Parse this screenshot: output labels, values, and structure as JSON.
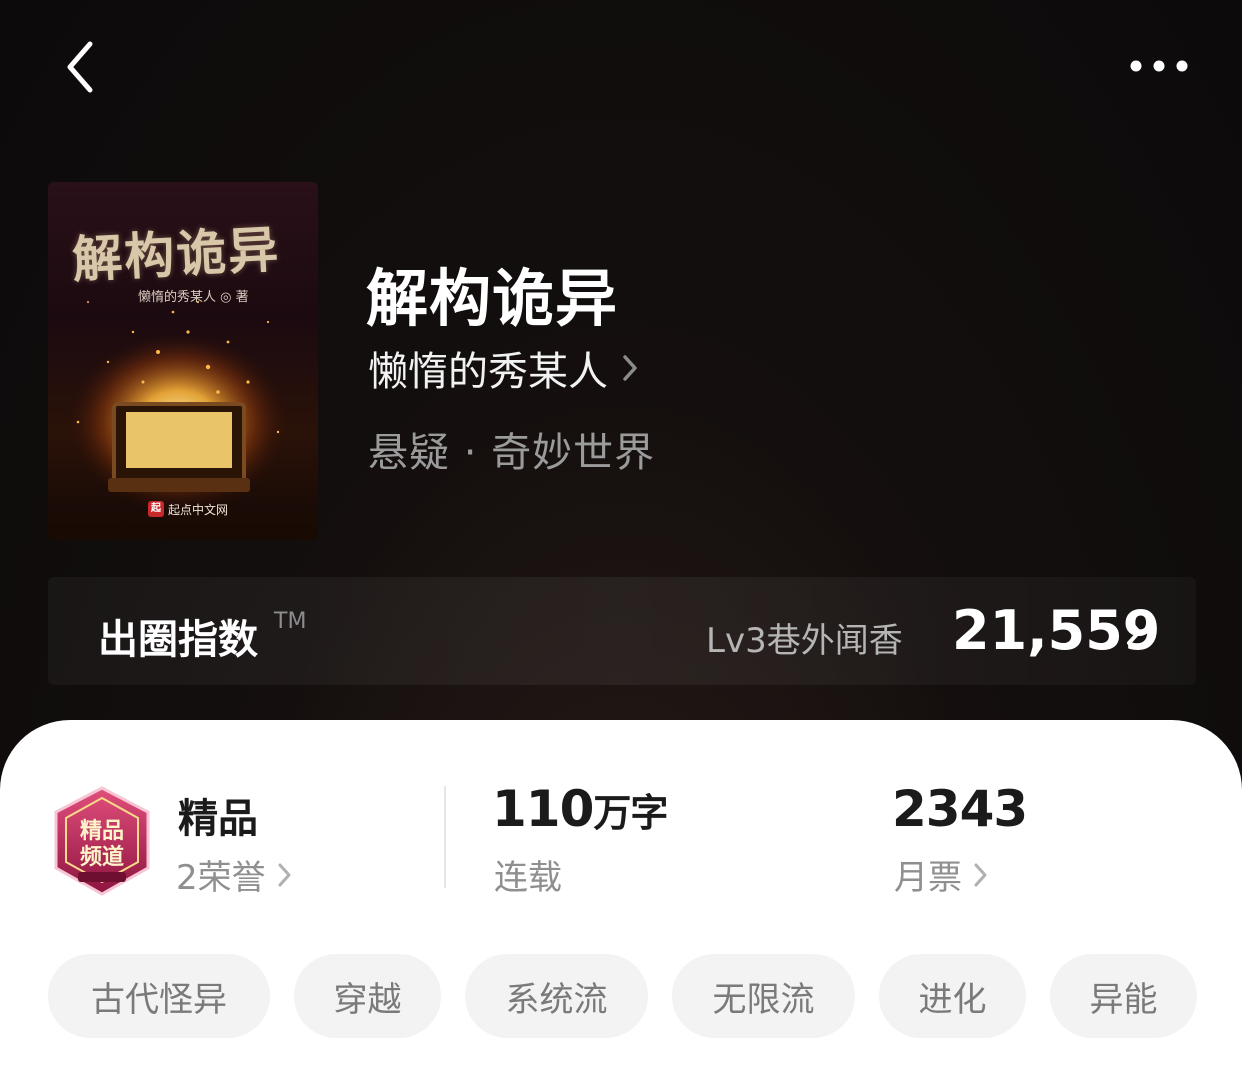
{
  "nav": {
    "back_icon": "chevron-left-icon",
    "more_icon": "more-dots-icon"
  },
  "cover": {
    "title": "解构诡异",
    "author": "懒惰的秀某人 ◎ 著",
    "publisher": "起点中文网",
    "publisher_mark": "起"
  },
  "book": {
    "title": "解构诡异",
    "author": "懒惰的秀某人",
    "genre": "悬疑 · 奇妙世界"
  },
  "popularity": {
    "label": "出圈指数",
    "tm": "TM",
    "level": "Lv3巷外闻香",
    "value": "21,559"
  },
  "stats": {
    "badge_text": "精品频道",
    "quality": {
      "title": "精品",
      "sub": "2荣誉"
    },
    "words": {
      "number": "110",
      "unit": "万字",
      "sub": "连载"
    },
    "tickets": {
      "number": "2343",
      "sub": "月票"
    }
  },
  "tags": [
    "古代怪异",
    "穿越",
    "系统流",
    "无限流",
    "进化",
    "异能"
  ],
  "colors": {
    "background": "#0c0a0b",
    "card": "#ffffff",
    "tag_bg": "#f3f3f3",
    "badge": "#b8285a"
  }
}
